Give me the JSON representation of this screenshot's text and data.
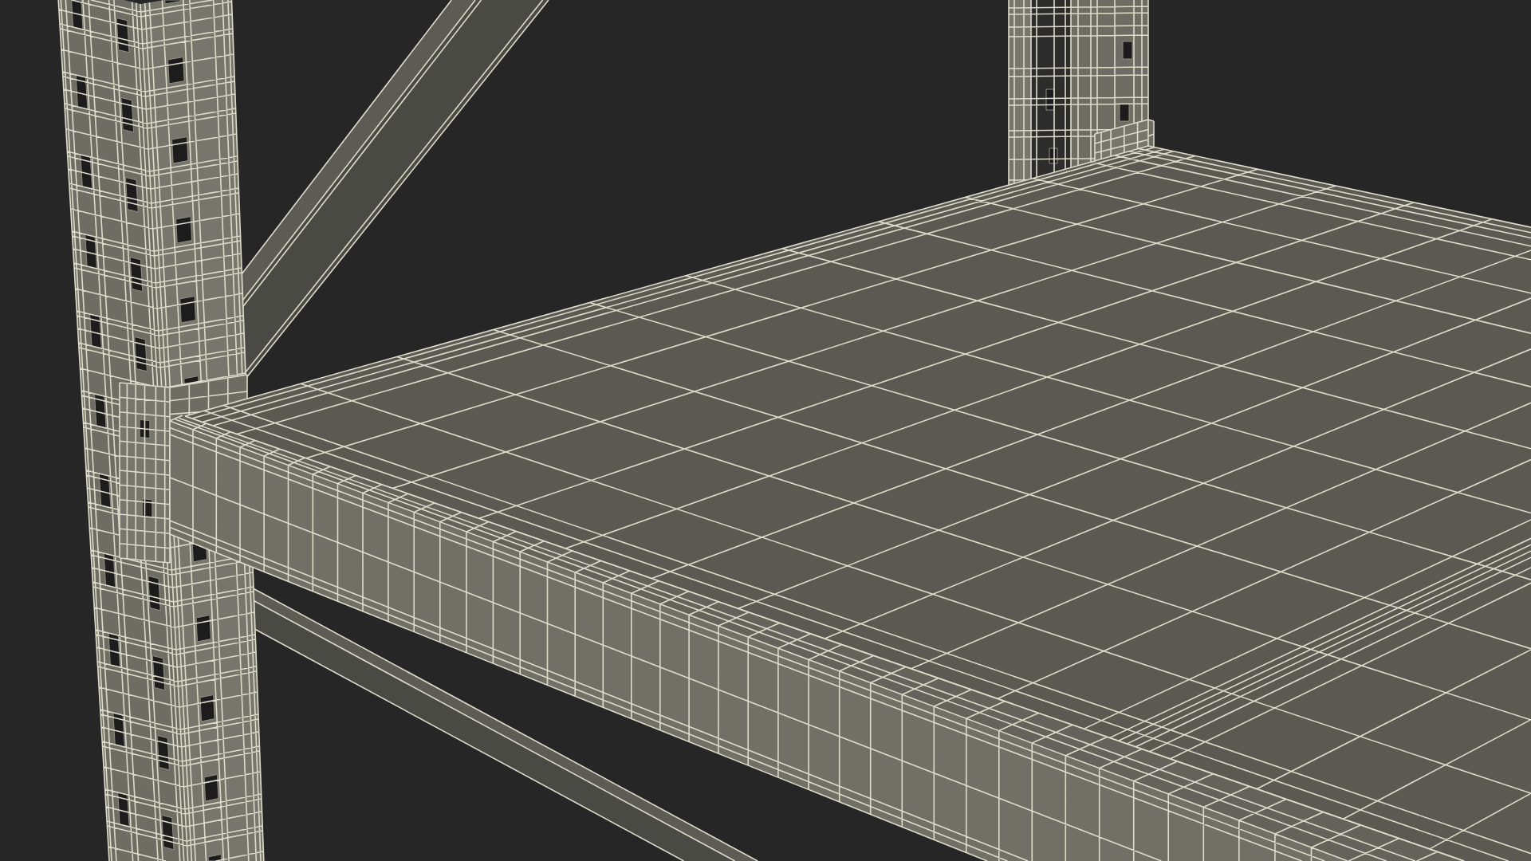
{
  "viewport": {
    "wireframe": true
  }
}
